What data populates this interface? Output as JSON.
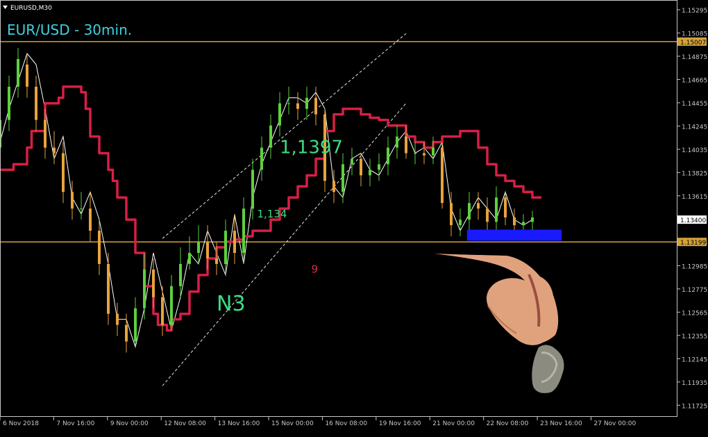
{
  "window": {
    "symbol_label": "EURUSD,M30",
    "dropdown_icon": "triangle-down-icon"
  },
  "chart_data": {
    "type": "line",
    "title": "EUR/USD - 30min.",
    "symbol": "EURUSD",
    "timeframe": "M30",
    "x_tick_labels": [
      "6 Nov 2018",
      "7 Nov 16:00",
      "9 Nov 00:00",
      "12 Nov 08:00",
      "13 Nov 16:00",
      "15 Nov 00:00",
      "16 Nov 08:00",
      "19 Nov 16:00",
      "21 Nov 00:00",
      "22 Nov 08:00",
      "23 Nov 16:00",
      "27 Nov 00:00"
    ],
    "y_tick_labels": [
      "1.15295",
      "1.15085",
      "1.14875",
      "1.14665",
      "1.14455",
      "1.14245",
      "1.14035",
      "1.13825",
      "1.13615",
      "1.13195",
      "1.12985",
      "1.12775",
      "1.12565",
      "1.12355",
      "1.12145",
      "1.11935",
      "1.11725"
    ],
    "ylim": [
      1.1162,
      1.1537
    ],
    "grid": false,
    "horizontal_levels": [
      {
        "value": 1.15007,
        "label": "1.15007",
        "color": "#d4a13a"
      },
      {
        "value": 1.13199,
        "label": "1.13199",
        "color": "#d4a13a"
      }
    ],
    "current_price": {
      "value": 1.134,
      "label": "1.13400"
    },
    "channel_lines": [
      {
        "from": [
          0,
          1.1323
        ],
        "to": [
          90,
          1.1508
        ]
      },
      {
        "from": [
          0,
          1.119
        ],
        "to": [
          90,
          1.1445
        ]
      }
    ],
    "annotations": [
      {
        "text": "1,1397",
        "x": 62,
        "y": 1.14,
        "color": "#3ddc84"
      },
      {
        "text": "1,134",
        "x": 57,
        "y": 1.1342,
        "color": "#3ddc84"
      },
      {
        "text": "N3",
        "x": 48,
        "y": 1.1258,
        "color": "#3ddc84"
      },
      {
        "text": "9",
        "x": 69,
        "y": 1.1292,
        "color": "#e0294f"
      }
    ],
    "support_zone": {
      "x0": 103.5,
      "x1": 124.5,
      "y0": 1.1321,
      "y1": 1.1331,
      "color": "#1a1aff"
    },
    "series": [
      {
        "type": "line",
        "color": "#ffffff",
        "x": [
          0,
          2,
          4,
          6,
          8,
          10,
          12,
          14,
          16,
          18,
          20,
          22,
          24,
          26,
          28,
          30,
          32,
          34,
          36,
          38,
          40,
          42,
          44,
          46,
          48,
          50,
          52,
          54,
          56,
          58,
          60,
          62,
          64,
          66,
          68,
          70,
          72,
          74,
          76,
          78,
          80,
          82,
          84,
          86,
          88,
          90,
          92,
          94,
          96,
          98,
          100,
          102,
          104,
          106,
          108,
          110,
          112,
          114,
          116,
          118
        ],
        "y": [
          1.141,
          1.144,
          1.1465,
          1.149,
          1.148,
          1.144,
          1.1395,
          1.1415,
          1.136,
          1.1345,
          1.1365,
          1.134,
          1.13,
          1.125,
          1.125,
          1.1225,
          1.126,
          1.131,
          1.1275,
          1.124,
          1.127,
          1.131,
          1.13,
          1.133,
          1.131,
          1.129,
          1.1345,
          1.13,
          1.136,
          1.139,
          1.141,
          1.143,
          1.145,
          1.145,
          1.1445,
          1.1455,
          1.144,
          1.137,
          1.136,
          1.1395,
          1.14,
          1.1385,
          1.138,
          1.1395,
          1.141,
          1.142,
          1.14,
          1.1405,
          1.1395,
          1.141,
          1.135,
          1.133,
          1.1345,
          1.136,
          1.135,
          1.134,
          1.1365,
          1.134,
          1.1335,
          1.134
        ]
      },
      {
        "type": "step",
        "color": "#d61f45",
        "x": [
          0,
          3,
          6,
          7,
          10,
          12,
          13,
          14,
          18,
          19,
          20,
          22,
          24,
          25,
          26,
          28,
          30,
          32,
          34,
          35,
          36,
          37,
          38,
          40,
          42,
          44,
          46,
          48,
          50,
          52,
          54,
          56,
          58,
          60,
          62,
          64,
          66,
          68,
          70,
          72,
          74,
          76,
          78,
          80,
          82,
          84,
          86,
          88,
          90,
          92,
          94,
          96,
          98,
          100,
          102,
          104,
          106,
          108,
          110,
          112,
          114,
          116,
          118,
          120
        ],
        "y": [
          1.1385,
          1.139,
          1.1405,
          1.142,
          1.1445,
          1.1445,
          1.145,
          1.146,
          1.1455,
          1.144,
          1.1415,
          1.14,
          1.1385,
          1.1375,
          1.136,
          1.134,
          1.131,
          1.128,
          1.1255,
          1.1245,
          1.1245,
          1.124,
          1.125,
          1.1255,
          1.1275,
          1.129,
          1.1305,
          1.1315,
          1.132,
          1.1322,
          1.1325,
          1.133,
          1.133,
          1.134,
          1.135,
          1.136,
          1.137,
          1.138,
          1.1395,
          1.142,
          1.1435,
          1.144,
          1.144,
          1.1435,
          1.1432,
          1.143,
          1.1425,
          1.1425,
          1.1415,
          1.141,
          1.1405,
          1.141,
          1.1415,
          1.1415,
          1.142,
          1.142,
          1.1405,
          1.139,
          1.138,
          1.1375,
          1.137,
          1.1365,
          1.136,
          1.136
        ]
      },
      {
        "type": "candles",
        "up_color": "#5dd13d",
        "down_color": "#e8a33d",
        "x": [
          0,
          2,
          4,
          6,
          8,
          10,
          12,
          14,
          16,
          18,
          20,
          22,
          24,
          26,
          28,
          30,
          32,
          34,
          36,
          38,
          40,
          42,
          44,
          46,
          48,
          50,
          52,
          54,
          56,
          58,
          60,
          62,
          64,
          66,
          68,
          70,
          72,
          74,
          76,
          78,
          80,
          82,
          84,
          86,
          88,
          90,
          92,
          94,
          96,
          98,
          100,
          102,
          104,
          106,
          108,
          110,
          112,
          114,
          116,
          118
        ],
        "open": [
          1.1405,
          1.143,
          1.146,
          1.148,
          1.146,
          1.143,
          1.1405,
          1.14,
          1.1365,
          1.135,
          1.135,
          1.133,
          1.13,
          1.1255,
          1.1245,
          1.123,
          1.126,
          1.1295,
          1.127,
          1.1245,
          1.128,
          1.13,
          1.131,
          1.132,
          1.1305,
          1.13,
          1.133,
          1.131,
          1.135,
          1.1385,
          1.1405,
          1.1425,
          1.1445,
          1.1445,
          1.144,
          1.145,
          1.1435,
          1.1375,
          1.1365,
          1.139,
          1.1395,
          1.138,
          1.1385,
          1.139,
          1.1405,
          1.1415,
          1.14,
          1.14,
          1.1398,
          1.1405,
          1.1355,
          1.1335,
          1.134,
          1.1355,
          1.135,
          1.1338,
          1.136,
          1.1342,
          1.1335,
          1.1338
        ],
        "close": [
          1.143,
          1.146,
          1.1485,
          1.146,
          1.143,
          1.1405,
          1.14,
          1.1365,
          1.135,
          1.135,
          1.133,
          1.13,
          1.1255,
          1.1245,
          1.123,
          1.126,
          1.1295,
          1.127,
          1.1245,
          1.128,
          1.13,
          1.131,
          1.132,
          1.1305,
          1.13,
          1.133,
          1.131,
          1.135,
          1.1385,
          1.1405,
          1.1425,
          1.1445,
          1.1445,
          1.144,
          1.145,
          1.1435,
          1.1375,
          1.1365,
          1.139,
          1.1395,
          1.138,
          1.1385,
          1.139,
          1.1405,
          1.1415,
          1.14,
          1.14,
          1.1398,
          1.1405,
          1.1355,
          1.1335,
          1.134,
          1.1355,
          1.135,
          1.1338,
          1.136,
          1.1342,
          1.1335,
          1.1338,
          1.1342
        ],
        "high": [
          1.144,
          1.147,
          1.1495,
          1.149,
          1.147,
          1.144,
          1.142,
          1.141,
          1.1375,
          1.1365,
          1.1365,
          1.134,
          1.131,
          1.1265,
          1.1255,
          1.127,
          1.131,
          1.1305,
          1.128,
          1.129,
          1.1315,
          1.1325,
          1.1335,
          1.1335,
          1.132,
          1.134,
          1.1345,
          1.136,
          1.1395,
          1.1415,
          1.1435,
          1.1455,
          1.146,
          1.1455,
          1.146,
          1.146,
          1.144,
          1.1385,
          1.14,
          1.1405,
          1.14,
          1.1395,
          1.14,
          1.1415,
          1.1425,
          1.1425,
          1.141,
          1.141,
          1.1415,
          1.141,
          1.1365,
          1.135,
          1.1365,
          1.1365,
          1.136,
          1.137,
          1.1365,
          1.135,
          1.1345,
          1.1348
        ],
        "low": [
          1.1395,
          1.142,
          1.145,
          1.145,
          1.142,
          1.1395,
          1.139,
          1.1355,
          1.134,
          1.134,
          1.132,
          1.129,
          1.1245,
          1.1235,
          1.122,
          1.1225,
          1.125,
          1.126,
          1.1235,
          1.124,
          1.127,
          1.1295,
          1.13,
          1.1295,
          1.129,
          1.129,
          1.13,
          1.13,
          1.134,
          1.1375,
          1.1395,
          1.1415,
          1.1435,
          1.143,
          1.143,
          1.1425,
          1.1365,
          1.1355,
          1.1355,
          1.138,
          1.137,
          1.137,
          1.1375,
          1.138,
          1.1395,
          1.1395,
          1.139,
          1.139,
          1.139,
          1.135,
          1.1325,
          1.1325,
          1.133,
          1.134,
          1.133,
          1.133,
          1.1335,
          1.1325,
          1.1325,
          1.133
        ]
      }
    ],
    "colors": {
      "background": "#000000",
      "axis": "#c8c8c8",
      "title": "#3fd0e0"
    }
  },
  "overlay": {
    "image": "hand-pouring-sand-photo"
  }
}
